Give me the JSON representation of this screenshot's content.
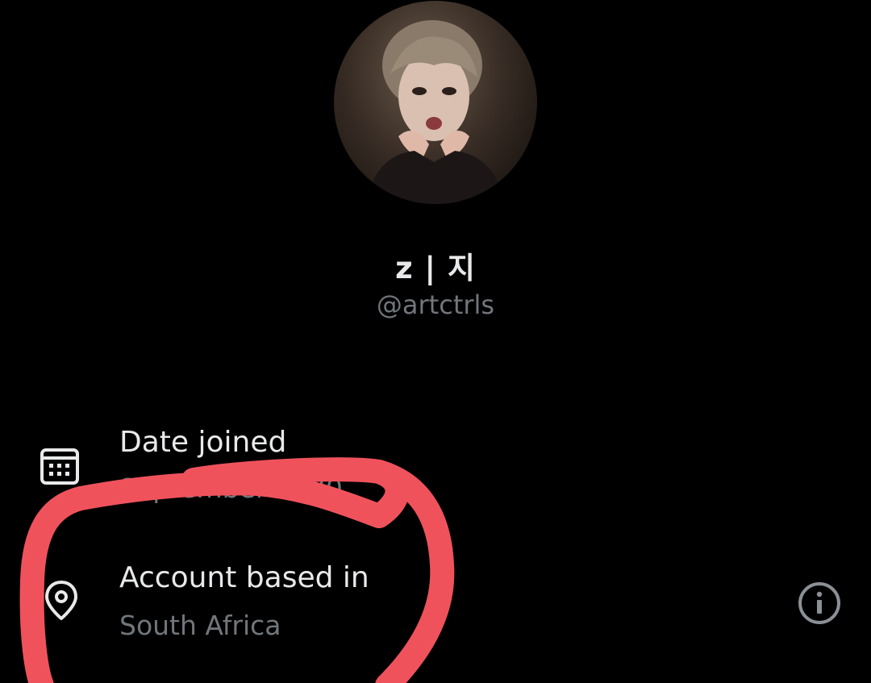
{
  "profile": {
    "display_name": "z | 지",
    "handle": "@artctrls"
  },
  "about_rows": [
    {
      "icon": "calendar-icon",
      "title": "Date joined",
      "value": "September 2020"
    },
    {
      "icon": "location-pin-icon",
      "title": "Account based in",
      "value": "South Africa"
    }
  ],
  "colors": {
    "background": "#000000",
    "primary_text": "#e7e9ea",
    "secondary_text": "#71767b",
    "annotation_red": "#f0525c"
  }
}
